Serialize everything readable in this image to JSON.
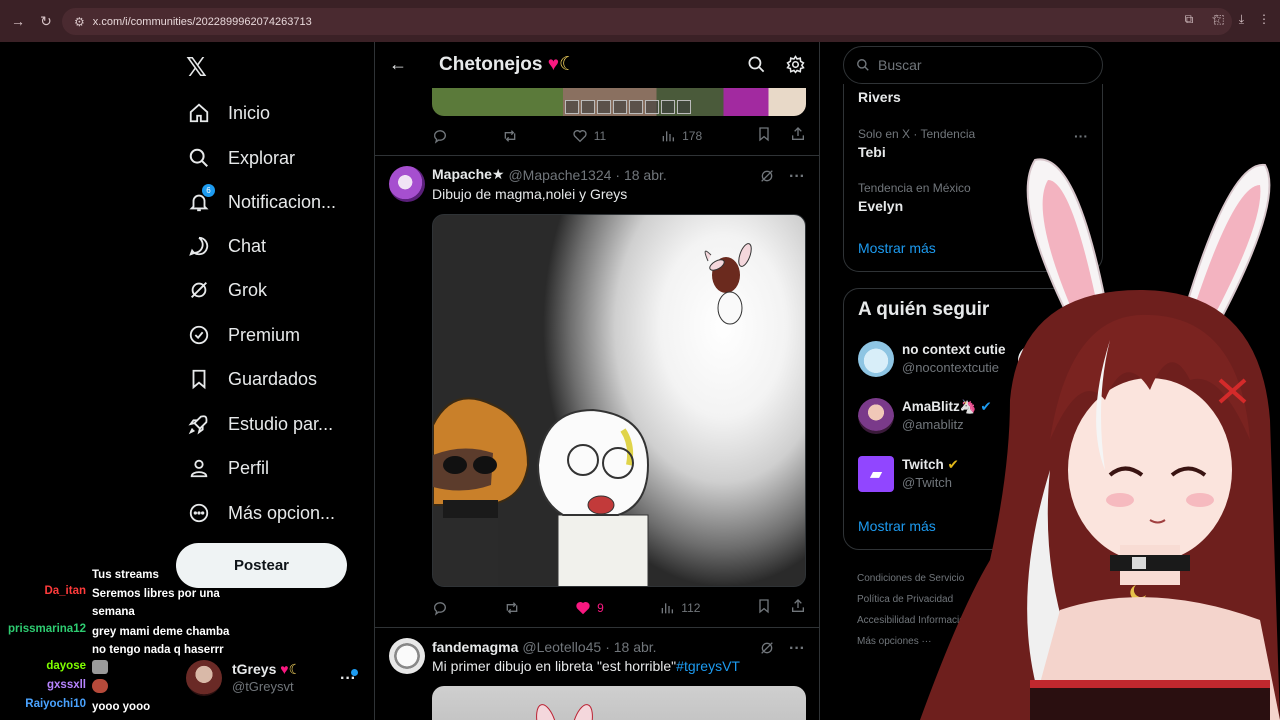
{
  "browser": {
    "url": "x.com/i/communities/2022899962074263713"
  },
  "nav": {
    "items": [
      {
        "label": "Inicio"
      },
      {
        "label": "Explorar"
      },
      {
        "label": "Notificacion...",
        "badge": "6"
      },
      {
        "label": "Chat"
      },
      {
        "label": "Grok"
      },
      {
        "label": "Premium"
      },
      {
        "label": "Guardados"
      },
      {
        "label": "Estudio par..."
      },
      {
        "label": "Perfil"
      },
      {
        "label": "Más opcion..."
      }
    ],
    "post_label": "Postear",
    "profile": {
      "name": "tGreys",
      "handle": "@tGreysvt"
    }
  },
  "community": {
    "title": "Chetonejos"
  },
  "posts": [
    {
      "stats": {
        "replies": "",
        "reposts": "",
        "likes": "11",
        "views": "178"
      }
    },
    {
      "name": "Mapache★",
      "handle": "@Mapache1324",
      "date": "· 18 abr.",
      "text": "Dibujo de magma,nolei y Greys",
      "stats": {
        "replies": "",
        "reposts": "",
        "likes": "9",
        "views": "112"
      }
    },
    {
      "name": "fandemagma",
      "handle": "@Leotello45",
      "date": "· 18 abr.",
      "text": "Mi primer dibujo en libreta \"est horrible\"",
      "hashtag": "#tgreysVT"
    }
  ],
  "search": {
    "placeholder": "Buscar"
  },
  "trends": [
    {
      "label": "",
      "name": "Rivers"
    },
    {
      "label": "Solo en X · Tendencia",
      "name": "Tebi"
    },
    {
      "label": "Tendencia en México",
      "name": "Evelyn"
    }
  ],
  "trends_more": "Mostrar más",
  "who_to_follow": {
    "title": "A quién seguir",
    "accounts": [
      {
        "name": "no context cutie",
        "handle": "@nocontextcutie"
      },
      {
        "name": "AmaBlitz🦄",
        "handle": "@amablitz"
      },
      {
        "name": "Twitch",
        "handle": "@Twitch"
      }
    ],
    "more": "Mostrar más"
  },
  "footer": {
    "links": [
      "Condiciones de Servicio",
      "Política de Privacidad",
      "Accesibilidad",
      "Información",
      "Más opciones ···"
    ]
  },
  "chat": [
    {
      "user": "",
      "message": "Tus streams",
      "color": "#ffffff"
    },
    {
      "user": "Da_itan",
      "message": "Seremos libres por una semana",
      "color": "#ff3b3b"
    },
    {
      "user": "prissmarina12",
      "message": "grey mami deme chamba no tengo nada q haserrr",
      "color": "#2ecc71"
    },
    {
      "user": "dayose",
      "message": "",
      "color": "#7fff00"
    },
    {
      "user": "gxssxll",
      "message": "",
      "color": "#b784ff"
    },
    {
      "user": "Raiyochi10",
      "message": "yooo yooo",
      "color": "#4aa3ff"
    }
  ],
  "colors": {
    "accent": "#1d9bf0",
    "like": "#f91880",
    "browser": "#3b2126"
  }
}
